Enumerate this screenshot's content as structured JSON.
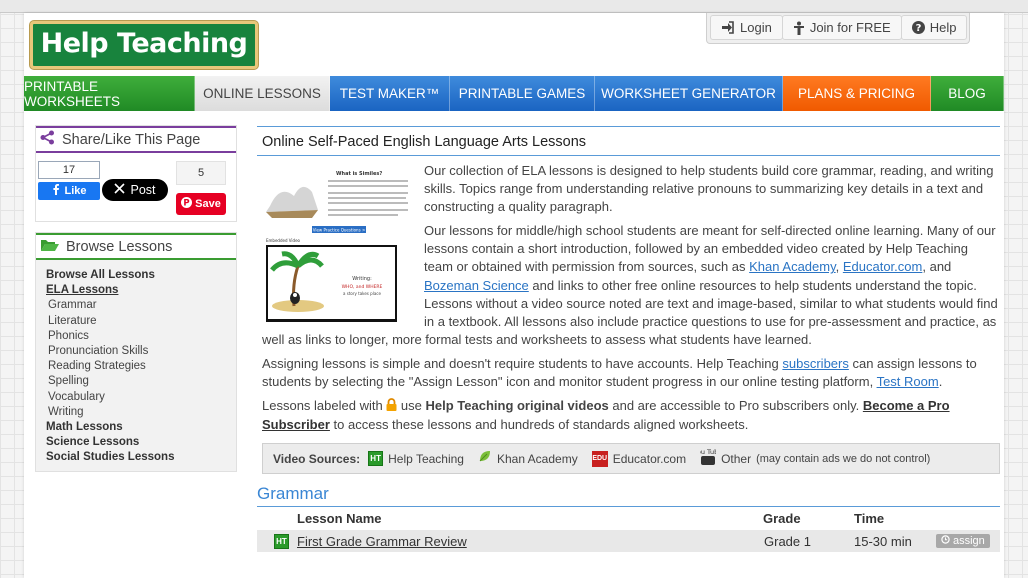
{
  "brand": {
    "logo_text": "Help Teaching"
  },
  "userbar": {
    "login": "Login",
    "join": "Join for FREE",
    "help": "Help"
  },
  "nav": [
    {
      "label": "PRINTABLE WORKSHEETS"
    },
    {
      "label": "ONLINE LESSONS"
    },
    {
      "label": "TEST MAKER™"
    },
    {
      "label": "PRINTABLE GAMES"
    },
    {
      "label": "WORKSHEET GENERATOR"
    },
    {
      "label": "PLANS & PRICING"
    },
    {
      "label": "BLOG"
    }
  ],
  "colors": {
    "nav_green": "#2f9d30",
    "nav_blue": "#2a75cf",
    "nav_orange": "#f96a0e",
    "link": "#2a74c4",
    "share_purple": "#7a3e9d"
  },
  "share": {
    "title": "Share/Like This Page",
    "fb_count": "17",
    "fb_like": "Like",
    "x_post": "Post",
    "pin_count": "5",
    "pin_save": "Save"
  },
  "browse": {
    "title": "Browse Lessons",
    "items": [
      {
        "label": "Browse All Lessons",
        "type": "cat"
      },
      {
        "label": "ELA Lessons",
        "type": "active"
      },
      {
        "label": "Grammar",
        "type": "sub"
      },
      {
        "label": "Literature",
        "type": "sub"
      },
      {
        "label": "Phonics",
        "type": "sub"
      },
      {
        "label": "Pronunciation Skills",
        "type": "sub"
      },
      {
        "label": "Reading Strategies",
        "type": "sub"
      },
      {
        "label": "Spelling",
        "type": "sub"
      },
      {
        "label": "Vocabulary",
        "type": "sub"
      },
      {
        "label": "Writing",
        "type": "sub"
      },
      {
        "label": "Math Lessons",
        "type": "cat"
      },
      {
        "label": "Science Lessons",
        "type": "cat"
      },
      {
        "label": "Social Studies Lessons",
        "type": "cat"
      }
    ]
  },
  "main": {
    "title": "Online Self-Paced English Language Arts Lessons",
    "thumb": {
      "heading": "What is Similes?",
      "button": "View Practice Questions >",
      "video_label": "Embedded Video",
      "slide_line1": "Writing:",
      "slide_line2": "WHO, and WHERE",
      "slide_line3": "a story takes place"
    },
    "p1": "Our collection of ELA lessons is designed to help students build core grammar, reading, and writing skills. Topics range from understanding relative pronouns to summarizing key details in a text and constructing a quality paragraph.",
    "p2": {
      "a": "Our lessons for middle/high school students are meant for self-directed online learning. Many of our lessons contain a short introduction, followed by an embedded video created by Help Teaching team or obtained with permission from sources, such as ",
      "link1": "Khan Academy",
      "sep1": ", ",
      "link2": "Educator.com",
      "sep2": ", and ",
      "link3": "Bozeman Science",
      "b": " and links to other free online resources to help students understand the topic. Lessons without a video source noted are text and image-based, similar to what students would find in a textbook. All lessons also include practice questions to use for pre-assessment and practice, as well as links to longer, more formal tests and worksheets to assess what students have learned."
    },
    "p3": {
      "a": "Assigning lessons is simple and doesn't require students to have accounts. Help Teaching ",
      "link1": "subscribers",
      "b": " can assign lessons to students by selecting the \"Assign Lesson\" icon and monitor student progress in our online testing platform, ",
      "link2": "Test Room",
      "c": "."
    },
    "p4": {
      "a": "Lessons labeled with ",
      "b": " use ",
      "bold": "Help Teaching original videos",
      "c": " and are accessible to Pro subscribers only. ",
      "link": "Become a Pro Subscriber",
      "d": " to access these lessons and hundreds of standards aligned worksheets."
    },
    "sources": {
      "label": "Video Sources:",
      "ht_badge": "HT",
      "ht": "Help Teaching",
      "khan": "Khan Academy",
      "edu_badge": "EDU",
      "edu": "Educator.com",
      "yt_badge": "You Tube",
      "other": "Other",
      "other_note": "(may contain ads we do not control)"
    },
    "section": "Grammar",
    "table": {
      "headers": {
        "name": "Lesson Name",
        "grade": "Grade",
        "time": "Time"
      },
      "rows": [
        {
          "badge": "HT",
          "name": "First Grade Grammar Review",
          "grade": "Grade 1",
          "time": "15-30 min",
          "action": "assign"
        }
      ]
    }
  }
}
